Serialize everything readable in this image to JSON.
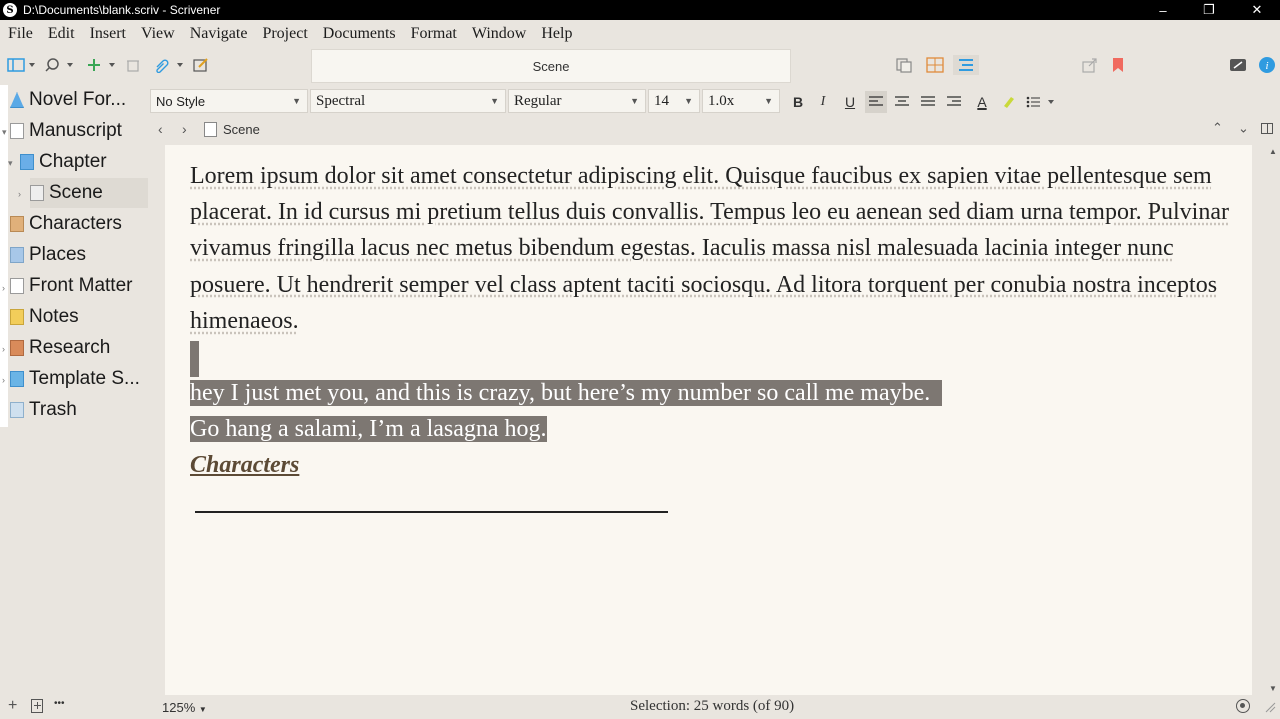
{
  "window": {
    "title": "D:\\Documents\\blank.scriv - Scrivener",
    "app_icon": "S",
    "minimize": "–",
    "restore": "❐",
    "close": "✕"
  },
  "menu": [
    "File",
    "Edit",
    "Insert",
    "View",
    "Navigate",
    "Project",
    "Documents",
    "Format",
    "Window",
    "Help"
  ],
  "toolbar": {
    "doc_title": "Scene"
  },
  "binder": {
    "items": [
      {
        "label": "Novel For...",
        "icon_color": "#5aa9e6"
      },
      {
        "label": "Manuscript",
        "icon_color": "#ffffff"
      },
      {
        "label": "Chapter",
        "icon_color": "#6aaee8"
      },
      {
        "label": "Scene",
        "icon_color": "#eeeeee"
      },
      {
        "label": "Characters",
        "icon_color": "#e0b07a"
      },
      {
        "label": "Places",
        "icon_color": "#a7c7e8"
      },
      {
        "label": "Front Matter",
        "icon_color": "#ffffff"
      },
      {
        "label": "Notes",
        "icon_color": "#f2cd5a"
      },
      {
        "label": "Research",
        "icon_color": "#d98b5a"
      },
      {
        "label": "Template S...",
        "icon_color": "#6ab4e6"
      },
      {
        "label": "Trash",
        "icon_color": "#cfe0ef"
      }
    ]
  },
  "format": {
    "style": "No Style",
    "font": "Spectral",
    "weight": "Regular",
    "size": "14",
    "spacing": "1.0x",
    "bold": "B",
    "italic": "I",
    "underline": "U",
    "text_color": "A"
  },
  "pathbar": {
    "doc": "Scene"
  },
  "document": {
    "paragraph1": "Lorem ipsum dolor sit amet consectetur adipiscing elit. Quisque faucibus ex sapien vitae pellentesque sem placerat. In id cursus mi pretium tellus duis convallis. Tempus leo eu aenean sed diam urna tempor. Pulvinar vivamus fringilla lacus nec metus bibendum egestas. Iaculis massa nisl malesuada lacinia integer nunc posuere. Ut hendrerit semper vel class aptent taciti sociosqu. Ad litora torquent per conubia nostra inceptos himenaeos.",
    "selected_line1": "hey I just met you, and this is crazy, but here’s my number so call me maybe.",
    "selected_line2": "Go hang a salami, I’m a lasagna hog.",
    "heading": "Characters"
  },
  "status": {
    "zoom": "125%",
    "selection": "Selection: 25 words (of 90)",
    "more": "•••"
  },
  "colors": {
    "selection_bg": "#7d7772",
    "editor_bg": "#faf7f1",
    "accent_blue": "#2f9be0",
    "bookmark_red": "#f06a5f"
  }
}
